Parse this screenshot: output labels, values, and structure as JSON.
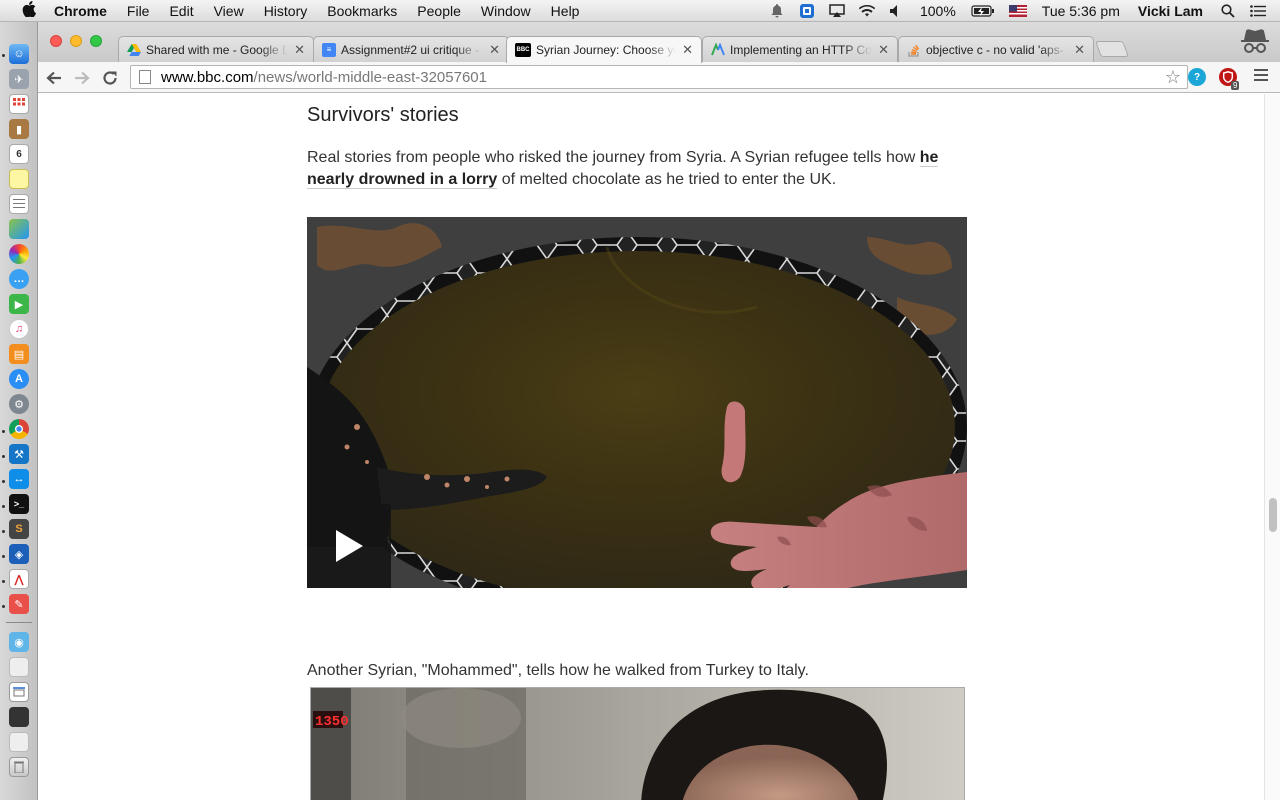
{
  "menubar": {
    "app_name": "Chrome",
    "items": [
      "File",
      "Edit",
      "View",
      "History",
      "Bookmarks",
      "People",
      "Window",
      "Help"
    ],
    "battery": "100%",
    "clock": "Tue 5:36 pm",
    "user": "Vicki Lam"
  },
  "tabs": [
    {
      "title": "Shared with me - Google D",
      "favicon": "google-drive-icon",
      "active": false
    },
    {
      "title": "Assignment#2 ui critique -",
      "favicon": "google-docs-icon",
      "active": false
    },
    {
      "title": "Syrian Journey: Choose yo",
      "favicon": "bbc-icon",
      "active": true
    },
    {
      "title": "Implementing an HTTP Cor",
      "favicon": "generic-site-icon",
      "active": false
    },
    {
      "title": "objective c - no valid 'aps-",
      "favicon": "stackoverflow-icon",
      "active": false
    }
  ],
  "address_bar": {
    "host": "www.bbc.com",
    "path": "/news/world-middle-east-32057601"
  },
  "extensions": {
    "ublock_badge": "9"
  },
  "article": {
    "section_heading": "Survivors' stories",
    "para1_start": "Real stories from people who risked the journey from Syria. A Syrian refugee tells how ",
    "para1_link": "he nearly drowned in a lorry",
    "para1_end": " of melted chocolate as he tried to enter the UK.",
    "para2": "Another Syrian, \"Mohammed\", tells how he walked from Turkey to Italy.",
    "photo_clock": "1350"
  },
  "colors": {
    "accent_blue": "#1a73e8",
    "bbc_black": "#000000",
    "link_text": "#222222"
  }
}
